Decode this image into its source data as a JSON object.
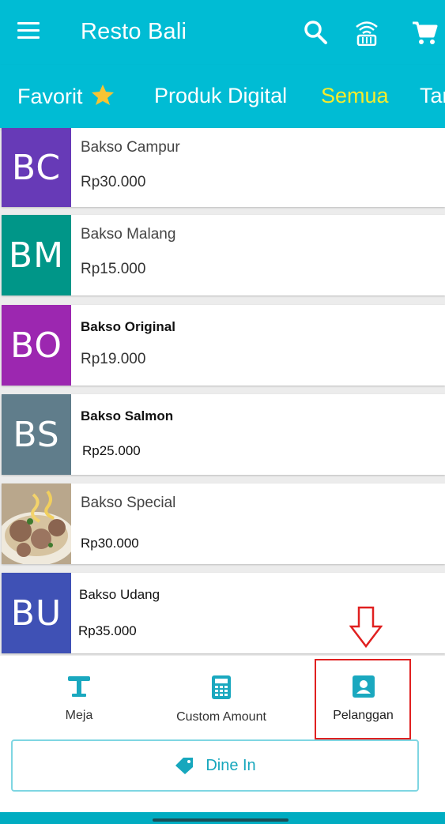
{
  "app": {
    "title": "Resto Bali",
    "icons": [
      "menu-icon",
      "search-icon",
      "wifi-basket-icon",
      "cart-icon"
    ]
  },
  "tabs": [
    {
      "label": "Favorit",
      "icon": "star-icon"
    },
    {
      "label": "Produk Digital"
    },
    {
      "label": "Semua",
      "active": true
    },
    {
      "label": "Tan"
    }
  ],
  "colors": {
    "primary": "#00bcd4",
    "active_tab": "#f7ec2a",
    "highlight": "#e02020"
  },
  "products": [
    {
      "initials": "BC",
      "name": "Bakso Campur",
      "price": "Rp30.000",
      "color": "#673ab7"
    },
    {
      "initials": "BM",
      "name": "Bakso Malang",
      "price": "Rp15.000",
      "color": "#009688"
    },
    {
      "initials": "BO",
      "name": "Bakso Original",
      "price": "Rp19.000",
      "color": "#9c27b0"
    },
    {
      "initials": "BS",
      "name": "Bakso Salmon",
      "price": "Rp25.000",
      "color": "#607d8b"
    },
    {
      "initials": "",
      "name": "Bakso Special",
      "price": "Rp30.000",
      "color": "#c9b9a3",
      "image": "meatball-soup-photo"
    },
    {
      "initials": "BU",
      "name": "Bakso Udang",
      "price": "Rp35.000",
      "color": "#3f51b5"
    }
  ],
  "bottom_nav": [
    {
      "label": "Meja",
      "icon": "table-icon"
    },
    {
      "label": "Custom Amount",
      "icon": "calculator-icon"
    },
    {
      "label": "Pelanggan",
      "icon": "customer-icon"
    }
  ],
  "dine_in": {
    "label": "Dine In",
    "icon": "tag-icon"
  }
}
